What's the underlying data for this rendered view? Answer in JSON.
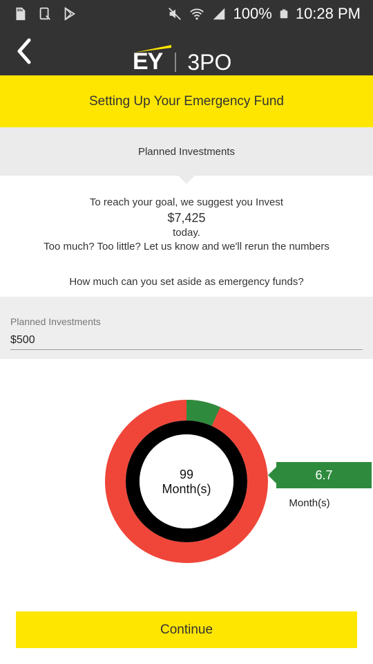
{
  "status_bar": {
    "battery": "100%",
    "time": "10:28 PM",
    "icons": [
      "sd-card-icon",
      "screenshot-icon",
      "play-store-icon",
      "mute-icon",
      "wifi-icon",
      "signal-icon",
      "battery-icon"
    ]
  },
  "app_bar": {
    "back_icon": "chevron-left-icon",
    "logo_brand": "EY",
    "logo_app": "3PO"
  },
  "page_title": "Setting Up Your Emergency Fund",
  "section_title": "Planned Investments",
  "suggestion": {
    "line1": "To reach your goal, we suggest you Invest",
    "amount": "$7,425",
    "line3": "today.",
    "line4": "Too much? Too little? Let us know and we'll rerun the numbers"
  },
  "question": "How much can you set aside as emergency funds?",
  "input": {
    "label": "Planned Investments",
    "value": "$500"
  },
  "chart": {
    "center_value": "99",
    "center_unit": "Month(s)",
    "callout_value": "6.7",
    "callout_unit": "Month(s)",
    "progress_fraction": 0.068,
    "colors": {
      "remaining": "#f0463a",
      "progress": "#2e8b3e",
      "inner": "#000000"
    }
  },
  "continue_label": "Continue",
  "colors": {
    "accent": "#ffe600",
    "dark": "#333333"
  }
}
